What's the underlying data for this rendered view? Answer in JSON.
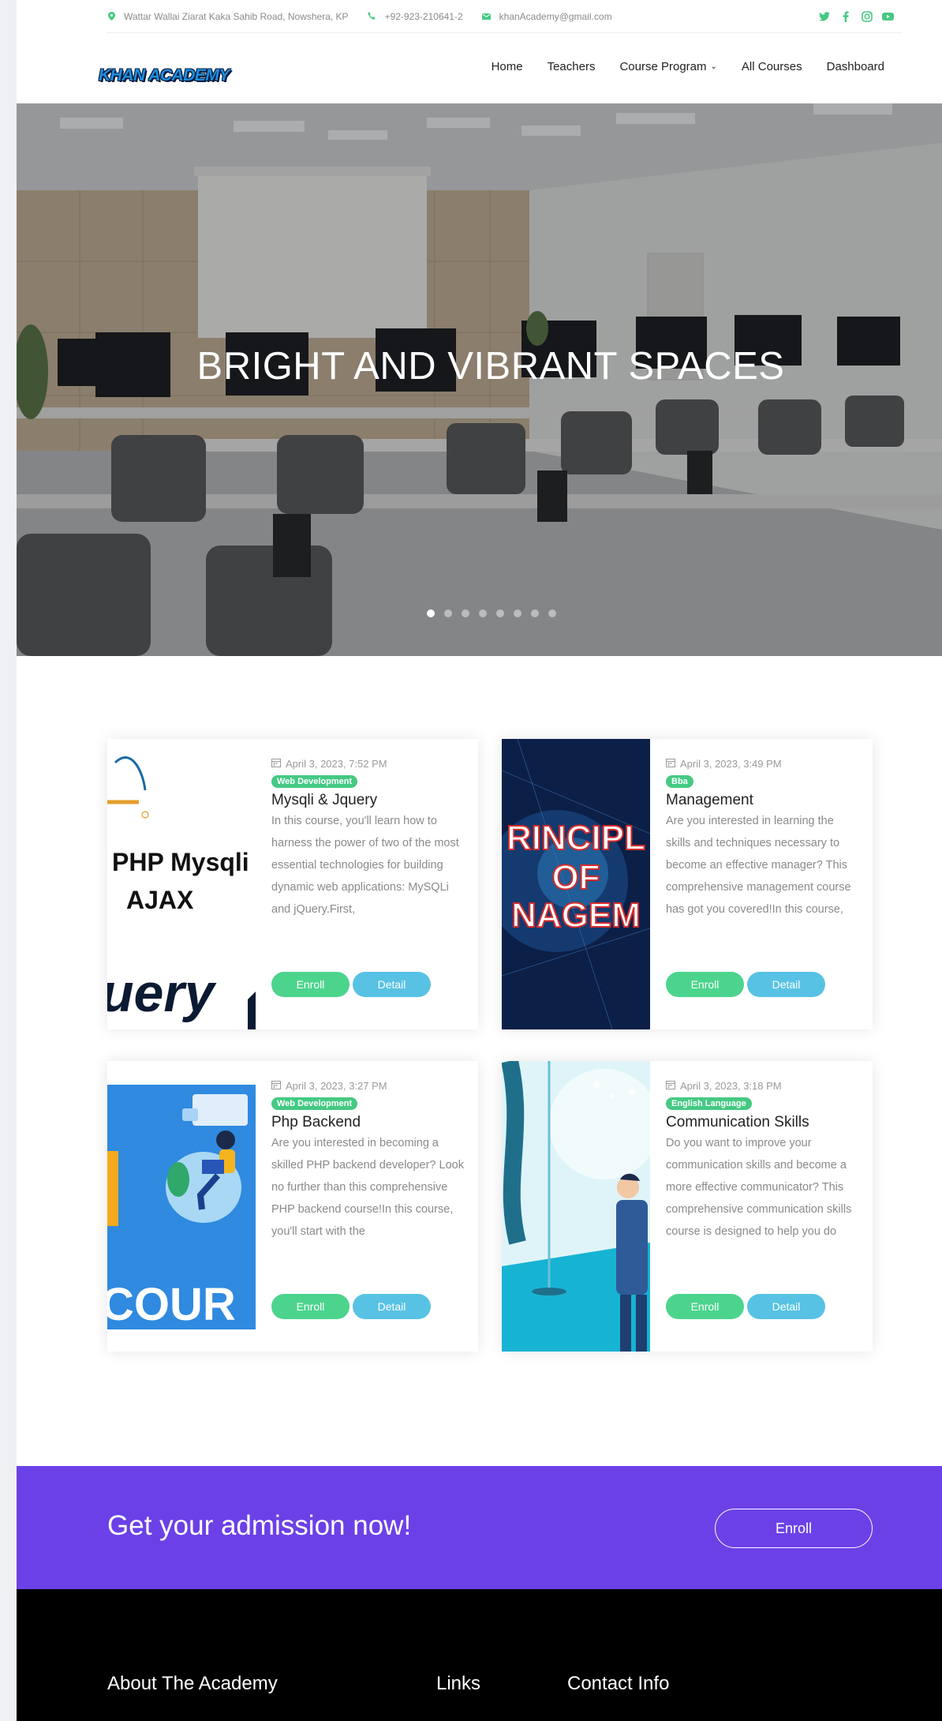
{
  "topbar": {
    "address": "Wattar Wallai Ziarat Kaka Sahib Road, Nowshera, KP",
    "phone": "+92-923-210641-2",
    "email": "khanAcademy@gmail.com",
    "social": [
      "twitter-icon",
      "facebook-icon",
      "instagram-icon",
      "youtube-icon"
    ],
    "accent": "#45c983"
  },
  "header": {
    "logo": "KHAN ACADEMY",
    "nav": [
      {
        "label": "Home"
      },
      {
        "label": "Teachers"
      },
      {
        "label": "Course Program"
      },
      {
        "label": "All Courses"
      },
      {
        "label": "Dashboard"
      }
    ]
  },
  "hero": {
    "title": "BRIGHT AND VIBRANT SPACES",
    "slide_count": 8,
    "active_slide": 1
  },
  "courses": [
    {
      "date": "April 3, 2023, 7:52 PM",
      "category": "Web Development",
      "title": "Mysqli & Jquery",
      "description": "In this course, you'll learn how to harness the power of two of the most essential technologies for building dynamic web applications: MySQLi and jQuery.First,",
      "thumb_text": [
        "PHP Mysqli",
        "AJAX",
        "uery"
      ],
      "enroll": "Enroll",
      "detail": "Detail"
    },
    {
      "date": "April 3, 2023, 3:49 PM",
      "category": "Bba",
      "title": "Management",
      "description": "Are you interested in learning the skills and techniques necessary to become an effective manager? This comprehensive management course has got you covered!In this course,",
      "thumb_text": [
        "RINCIPL",
        "OF",
        "NAGEM"
      ],
      "enroll": "Enroll",
      "detail": "Detail"
    },
    {
      "date": "April 3, 2023, 3:27 PM",
      "category": "Web Development",
      "title": "Php Backend",
      "description": "Are you interested in becoming a skilled PHP backend developer? Look no further than this comprehensive PHP backend course!In this course, you'll start with the",
      "thumb_text": [
        "COUR"
      ],
      "enroll": "Enroll",
      "detail": "Detail"
    },
    {
      "date": "April 3, 2023, 3:18 PM",
      "category": "English Language",
      "title": "Communication Skills",
      "description": "Do you want to improve your communication skills and become a more effective communicator? This comprehensive communication skills course is designed to help you do",
      "thumb_text": [],
      "enroll": "Enroll",
      "detail": "Detail"
    }
  ],
  "cta": {
    "text": "Get your admission now!",
    "button": "Enroll",
    "color": "#6b41e7"
  },
  "footer": {
    "about": "About The Academy",
    "links": "Links",
    "contact": "Contact Info"
  }
}
